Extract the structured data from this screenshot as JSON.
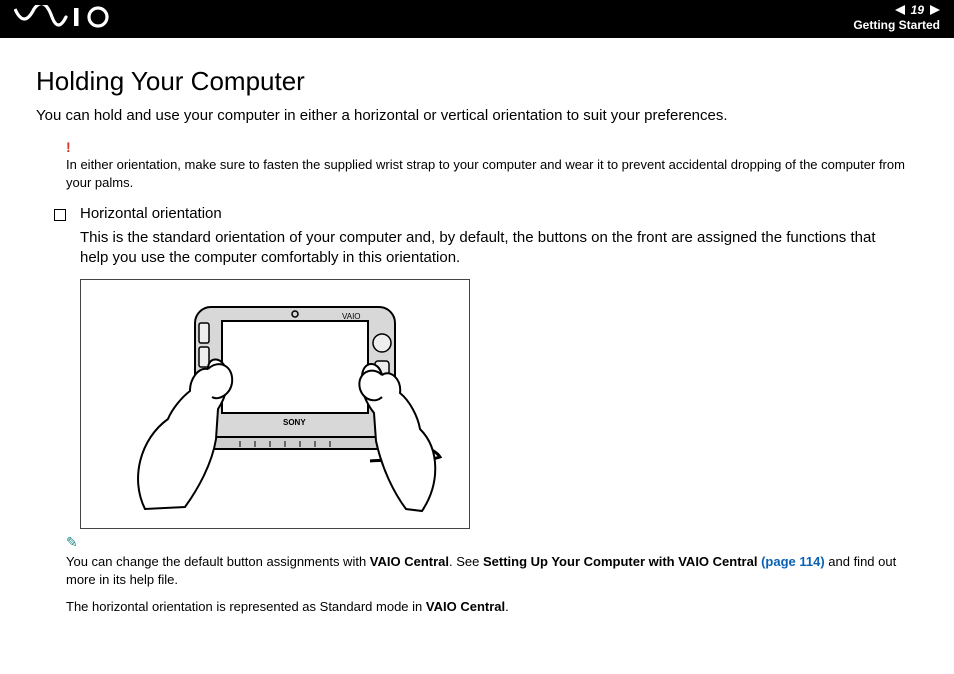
{
  "header": {
    "logo_alt": "VAIO",
    "page_number": "19",
    "section": "Getting Started"
  },
  "title": "Holding Your Computer",
  "intro": "You can hold and use your computer in either a horizontal or vertical orientation to suit your preferences.",
  "warning": {
    "mark": "!",
    "text": "In either orientation, make sure to fasten the supplied wrist strap to your computer and wear it to prevent accidental dropping of the computer from your palms."
  },
  "bullet": {
    "label": "Horizontal orientation",
    "desc": "This is the standard orientation of your computer and, by default, the buttons on the front are assigned the functions that help you use the computer comfortably in this orientation."
  },
  "tip": {
    "mark": "✎",
    "prefix": "You can change the default button assignments with ",
    "b1": "VAIO Central",
    "mid1": ". See ",
    "b2": "Setting Up Your Computer with VAIO Central ",
    "link": "(page 114)",
    "suffix": " and find out more in its help file."
  },
  "footer": {
    "prefix": "The horizontal orientation is represented as Standard mode in ",
    "b": "VAIO Central",
    "suffix": "."
  }
}
